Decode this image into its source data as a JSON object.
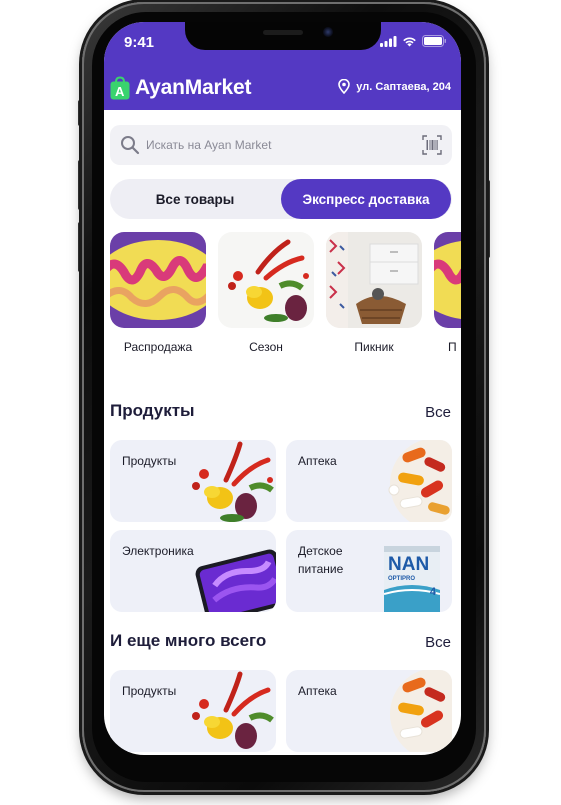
{
  "status_bar": {
    "time": "9:41"
  },
  "header": {
    "app_name": "AyanMarket",
    "logo_letter": "A",
    "address": "ул. Саптаева, 204"
  },
  "search": {
    "placeholder": "Искать на Ayan Market"
  },
  "tabs": [
    {
      "label": "Все товары",
      "active": false
    },
    {
      "label": "Экспресс доставка",
      "active": true
    }
  ],
  "stories": [
    {
      "label": "Распродажа"
    },
    {
      "label": "Сезон"
    },
    {
      "label": "Пикник"
    },
    {
      "label": "П"
    }
  ],
  "sections": [
    {
      "title": "Продукты",
      "all_label": "Все",
      "cards": [
        {
          "label": "Продукты"
        },
        {
          "label": "Аптека"
        },
        {
          "label": "Электроника"
        },
        {
          "label": "Детское\nпитание"
        }
      ]
    },
    {
      "title": "И еще много всего",
      "all_label": "Все",
      "cards": [
        {
          "label": "Продукты"
        },
        {
          "label": "Аптека"
        }
      ]
    }
  ],
  "product_badges": {
    "nan_brand": "NAN",
    "nan_sub": "OPTIPRO",
    "nan_stage": "4"
  },
  "colors": {
    "brand": "#5439c3",
    "card_bg": "#eef0f8",
    "search_bg": "#f1f1f5",
    "text": "#1e1d3a"
  }
}
